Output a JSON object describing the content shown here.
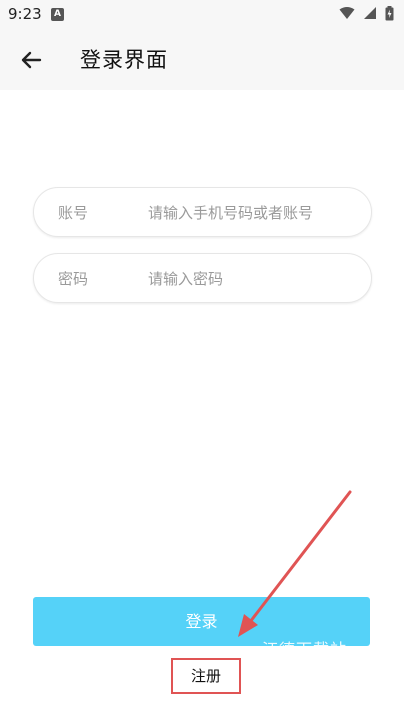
{
  "status_bar": {
    "time": "9:23",
    "notification_icon_letter": "A",
    "icons": [
      "wifi-icon",
      "signal-icon",
      "battery-icon"
    ]
  },
  "app_bar": {
    "title": "登录界面",
    "back_icon": "arrow-left-icon"
  },
  "form": {
    "account": {
      "label": "账号",
      "placeholder": "请输入手机号码或者账号",
      "value": ""
    },
    "password": {
      "label": "密码",
      "placeholder": "请输入密码",
      "value": ""
    }
  },
  "actions": {
    "login_label": "登录",
    "register_label": "注册"
  },
  "watermark": "汪德下载站",
  "colors": {
    "login_button": "#55d2f8",
    "annotation": "#e05454",
    "app_bar_background": "#f7f7f7"
  }
}
